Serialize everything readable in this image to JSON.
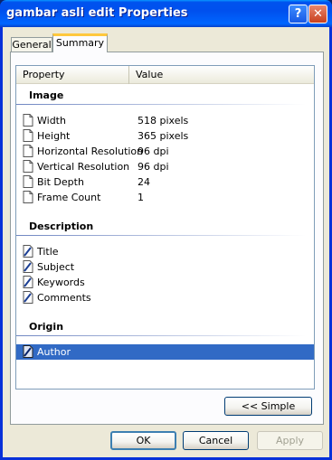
{
  "window": {
    "title": "gambar asli edit Properties",
    "help_label": "?",
    "close_label": "✕"
  },
  "tabs": [
    {
      "label": "General"
    },
    {
      "label": "Summary"
    }
  ],
  "columns": {
    "property": "Property",
    "value": "Value"
  },
  "groups": {
    "image": {
      "label": "Image",
      "rows": [
        {
          "property": "Width",
          "value": "518 pixels"
        },
        {
          "property": "Height",
          "value": "365 pixels"
        },
        {
          "property": "Horizontal Resolution",
          "value": "96 dpi"
        },
        {
          "property": "Vertical Resolution",
          "value": "96 dpi"
        },
        {
          "property": "Bit Depth",
          "value": "24"
        },
        {
          "property": "Frame Count",
          "value": "1"
        }
      ]
    },
    "description": {
      "label": "Description",
      "rows": [
        {
          "property": "Title"
        },
        {
          "property": "Subject"
        },
        {
          "property": "Keywords"
        },
        {
          "property": "Comments"
        }
      ]
    },
    "origin": {
      "label": "Origin",
      "rows": [
        {
          "property": "Author",
          "selected": true
        }
      ]
    }
  },
  "buttons": {
    "simple": "<< Simple",
    "ok": "OK",
    "cancel": "Cancel",
    "apply": "Apply"
  }
}
